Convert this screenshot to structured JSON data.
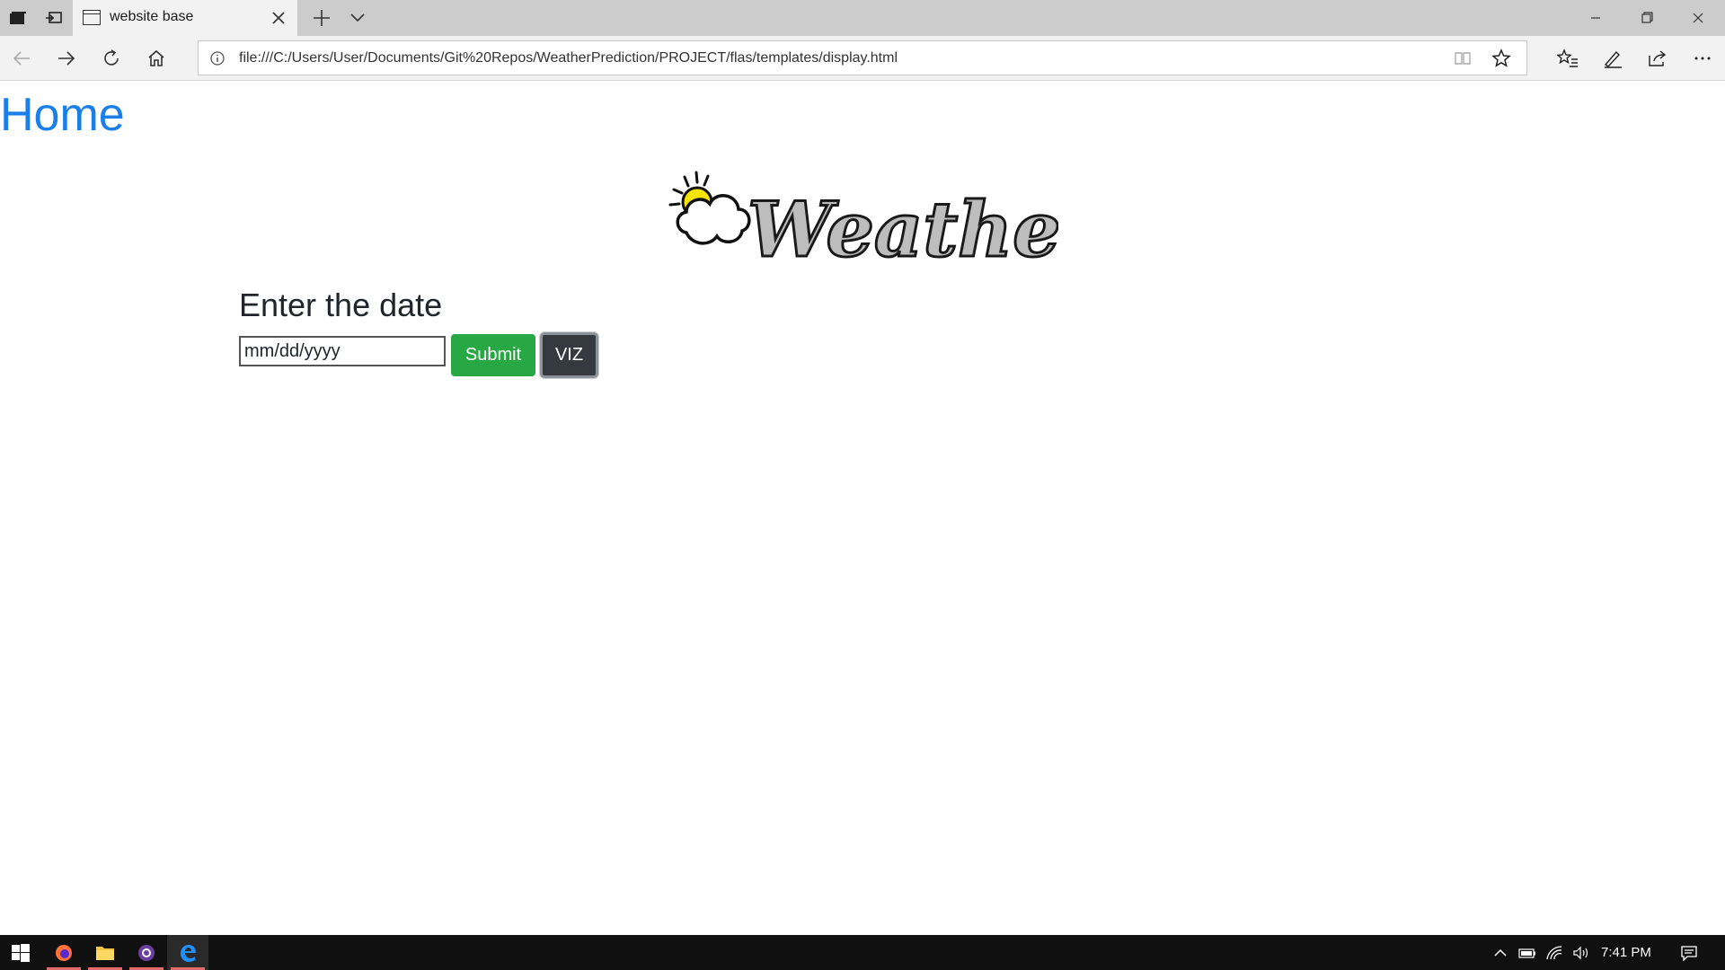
{
  "browser": {
    "tab": {
      "title": "website base"
    },
    "address": {
      "url": "file:///C:/Users/User/Documents/Git%20Repos/WeatherPrediction/PROJECT/flas/templates/display.html"
    }
  },
  "page": {
    "home_link": "Home",
    "logo_text": "WeatherApp",
    "prompt": "Enter the date",
    "date_placeholder": "mm/dd/yyyy",
    "submit_label": "Submit",
    "viz_label": "VIZ"
  },
  "taskbar": {
    "clock": "7:41 PM",
    "apps": [
      "firefox-icon",
      "file-explorer-icon",
      "media-app-icon",
      "edge-icon"
    ]
  },
  "colors": {
    "link": "#1a7fe8",
    "submit": "#28a745",
    "viz": "#343a40",
    "taskbar": "#101010"
  }
}
